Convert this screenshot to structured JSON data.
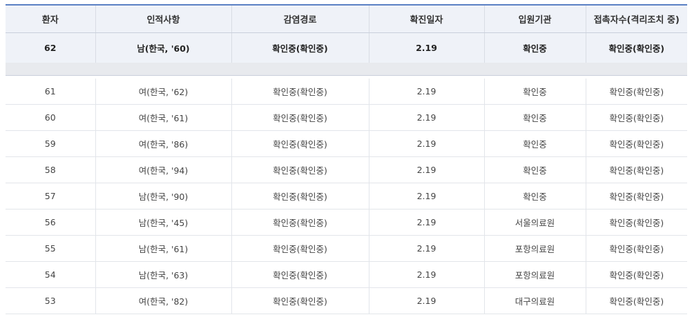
{
  "table": {
    "headers": [
      "환자",
      "인적사항",
      "감염경로",
      "확진일자",
      "입원기관",
      "접촉자수(격리조치 중)"
    ],
    "highlight_row": [
      "62",
      "남(한국, '60)",
      "확인중(확인중)",
      "2.19",
      "확인중",
      "확인중(확인중)"
    ],
    "rows": [
      [
        "61",
        "여(한국, '62)",
        "확인중(확인중)",
        "2.19",
        "확인중",
        "확인중(확인중)"
      ],
      [
        "60",
        "여(한국, '61)",
        "확인중(확인중)",
        "2.19",
        "확인중",
        "확인중(확인중)"
      ],
      [
        "59",
        "여(한국, '86)",
        "확인중(확인중)",
        "2.19",
        "확인중",
        "확인중(확인중)"
      ],
      [
        "58",
        "여(한국, '94)",
        "확인중(확인중)",
        "2.19",
        "확인중",
        "확인중(확인중)"
      ],
      [
        "57",
        "남(한국, '90)",
        "확인중(확인중)",
        "2.19",
        "확인중",
        "확인중(확인중)"
      ],
      [
        "56",
        "남(한국, '45)",
        "확인중(확인중)",
        "2.19",
        "서울의료원",
        "확인중(확인중)"
      ],
      [
        "55",
        "남(한국, '61)",
        "확인중(확인중)",
        "2.19",
        "포항의료원",
        "확인중(확인중)"
      ],
      [
        "54",
        "남(한국, '63)",
        "확인중(확인중)",
        "2.19",
        "포항의료원",
        "확인중(확인중)"
      ],
      [
        "53",
        "여(한국, '82)",
        "확인중(확인중)",
        "2.19",
        "대구의료원",
        "확인중(확인중)"
      ]
    ]
  },
  "colors": {
    "header_border": "#5a80c4",
    "header_bg": "#eff2f8"
  }
}
